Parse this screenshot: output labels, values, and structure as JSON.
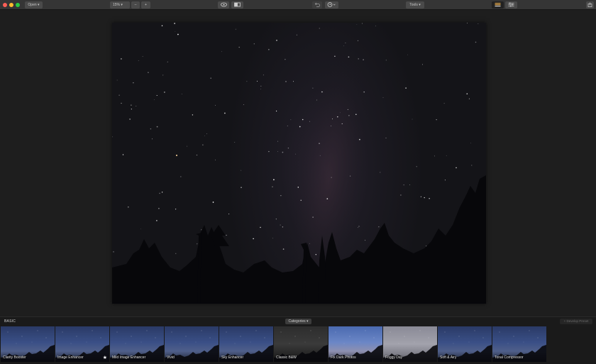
{
  "toolbar": {
    "open_label": "Open ▾",
    "zoom_value": "15% ▾",
    "zoom_out_label": "–",
    "zoom_in_label": "+",
    "tools_label": "Tools ▾"
  },
  "preset_panel": {
    "section_title": "BASIC",
    "categories_label": "Categories ▾",
    "develop_label": "+ Develop Preset",
    "presets": [
      {
        "label": "Clarity Booster",
        "style": "blue"
      },
      {
        "label": "Image Enhancer",
        "style": "blue",
        "favorite": "★"
      },
      {
        "label": "Mild Image Enhancer",
        "style": "blue"
      },
      {
        "label": "Vivid",
        "style": "blue"
      },
      {
        "label": "Sky Enhancer",
        "style": "blue"
      },
      {
        "label": "Classic B&W",
        "style": "bw"
      },
      {
        "label": "Fix Dark Photos",
        "style": "bright"
      },
      {
        "label": "Foggy Day",
        "style": "fog"
      },
      {
        "label": "Soft & Airy",
        "style": "blue"
      },
      {
        "label": "Tonal Compressor",
        "style": "blue"
      }
    ]
  },
  "colors": {
    "close": "#fc5f57",
    "minimize": "#fdbc2e",
    "maximize": "#29c941",
    "toolbar_bg": "#353535",
    "panel_bg": "#1a1a1a"
  }
}
